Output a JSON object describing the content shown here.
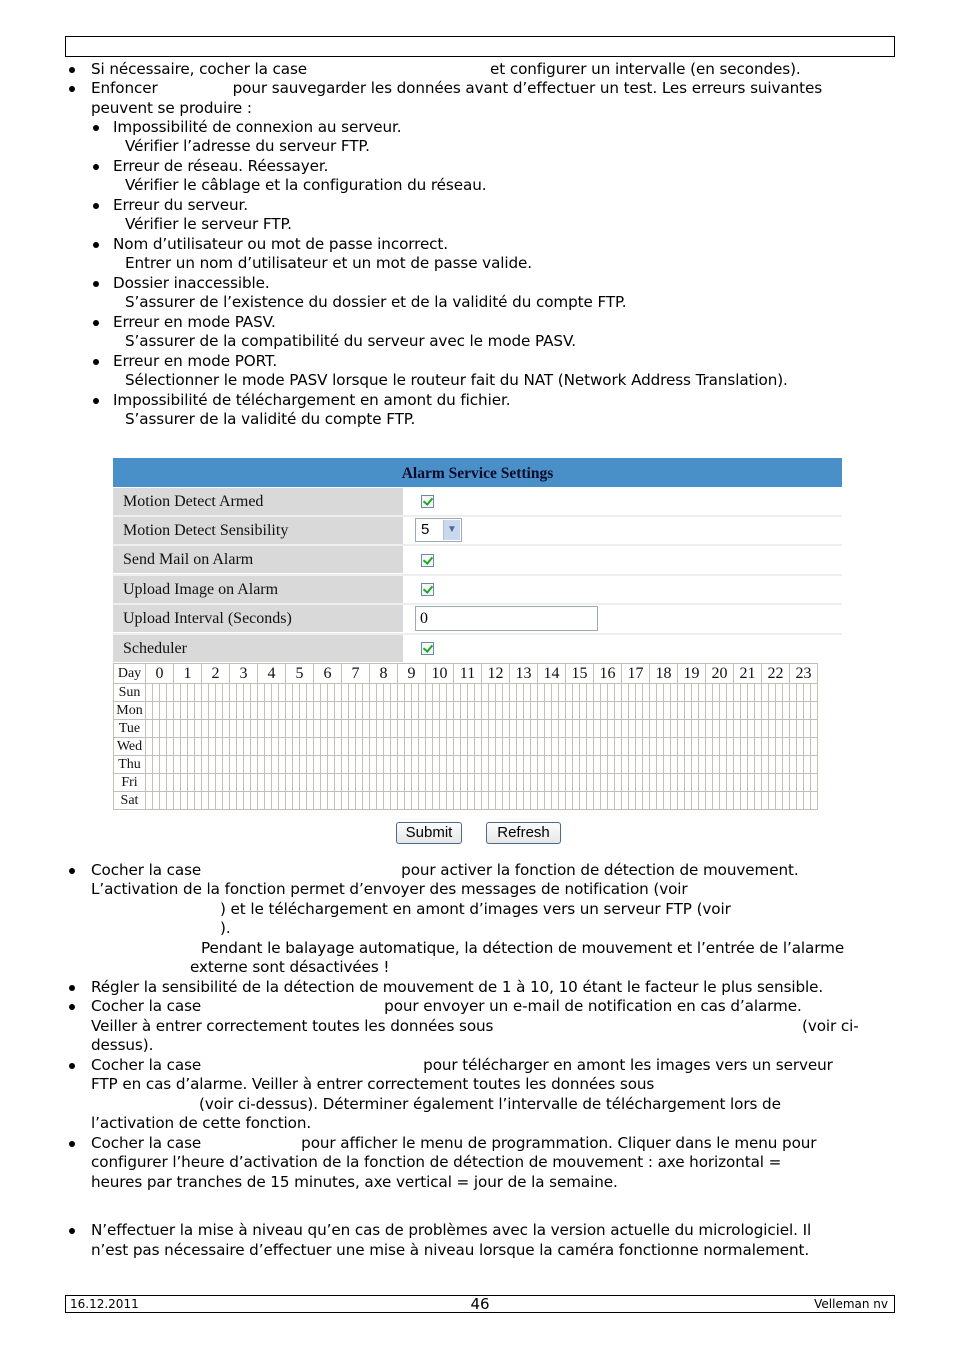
{
  "top_bullets": [
    {
      "a": "Si nécessaire, cocher la case",
      "b": "et configurer un intervalle (en secondes)."
    },
    {
      "a": "Enfoncer",
      "b": "pour sauvegarder les données avant d’effectuer un test. Les erreurs suivantes",
      "c": "peuvent se produire :"
    }
  ],
  "errors": [
    {
      "error": "Impossibilité de connexion au serveur.",
      "fix": "Vérifier l’adresse du serveur FTP."
    },
    {
      "error": "Erreur de réseau. Réessayer.",
      "fix": "Vérifier le câblage et la configuration du réseau."
    },
    {
      "error": "Erreur du serveur.",
      "fix": "Vérifier le serveur FTP."
    },
    {
      "error": "Nom d’utilisateur ou mot de passe incorrect.",
      "fix": "Entrer un nom d’utilisateur et un mot de passe valide."
    },
    {
      "error": "Dossier inaccessible.",
      "fix": "S’assurer de l’existence du dossier et de la validité du compte FTP."
    },
    {
      "error": "Erreur en mode PASV.",
      "fix": "S’assurer de la compatibilité du serveur avec le mode PASV."
    },
    {
      "error": "Erreur en mode PORT.",
      "fix": "Sélectionner le mode PASV lorsque le routeur fait du NAT (Network Address Translation)."
    },
    {
      "error": "Impossibilité de téléchargement en amont du fichier.",
      "fix": "S’assurer de la validité du compte FTP."
    }
  ],
  "panel": {
    "title": "Alarm Service Settings",
    "colors": {
      "header": "#4a90c8",
      "label_bg": "#d9d9d9",
      "check": "#1fa91f"
    },
    "rows": [
      {
        "label": "Motion Detect Armed",
        "type": "checkbox",
        "checked": true
      },
      {
        "label": "Motion Detect Sensibility",
        "type": "select",
        "value": "5"
      },
      {
        "label": "Send Mail on Alarm",
        "type": "checkbox",
        "checked": true
      },
      {
        "label": "Upload Image on Alarm",
        "type": "checkbox",
        "checked": true
      },
      {
        "label": "Upload Interval (Seconds)",
        "type": "text",
        "value": "0"
      },
      {
        "label": "Scheduler",
        "type": "checkbox",
        "checked": true
      }
    ],
    "scheduler": {
      "day_header": "Day",
      "hours": [
        "0",
        "1",
        "2",
        "3",
        "4",
        "5",
        "6",
        "7",
        "8",
        "9",
        "10",
        "11",
        "12",
        "13",
        "14",
        "15",
        "16",
        "17",
        "18",
        "19",
        "20",
        "21",
        "22",
        "23"
      ],
      "days": [
        "Sun",
        "Mon",
        "Tue",
        "Wed",
        "Thu",
        "Fri",
        "Sat"
      ],
      "slices_per_hour": 4
    },
    "submit_label": "Submit",
    "refresh_label": "Refresh"
  },
  "bottom": {
    "l1a": "Cocher la case",
    "l1b": "pour activer la fonction de détection de mouvement.",
    "l2": "L’activation de la fonction permet d’envoyer des messages de notification (voir",
    "l3": ") et le téléchargement en amont d’images vers un serveur FTP (voir",
    "l4": ").",
    "l5": "Pendant le balayage automatique, la détection de mouvement et l’entrée de l’alarme",
    "l6": "externe sont désactivées !",
    "l7": "Régler la sensibilité de la détection de mouvement de 1 à 10, 10 étant le facteur le plus sensible.",
    "l8a": "Cocher la case",
    "l8b": "pour envoyer un e-mail de notification en cas d’alarme.",
    "l9a": "Veiller à entrer correctement toutes les données sous",
    "l9b": "(voir ci-",
    "l10": "dessus).",
    "l11a": "Cocher la case",
    "l11b": "pour télécharger en amont les images vers un serveur",
    "l12": "FTP en cas d’alarme. Veiller à entrer correctement toutes les données sous",
    "l13": "(voir ci-dessus). Déterminer également l’intervalle de téléchargement lors de",
    "l14": "l’activation de cette fonction.",
    "l15a": "Cocher la case",
    "l15b": "pour afficher le menu de programmation. Cliquer dans le menu pour",
    "l16": "configurer l’heure d’activation de la fonction de détection de mouvement : axe horizontal =",
    "l17": "heures par tranches de 15 minutes, axe vertical = jour de la semaine.",
    "l18": "N’effectuer la mise à niveau qu’en cas de problèmes avec la version actuelle du micrologiciel. Il",
    "l19": "n’est pas nécessaire d’effectuer une mise à niveau lorsque la caméra fonctionne normalement."
  },
  "footer": {
    "date": "16.12.2011",
    "page": "46",
    "company": "Velleman nv"
  }
}
